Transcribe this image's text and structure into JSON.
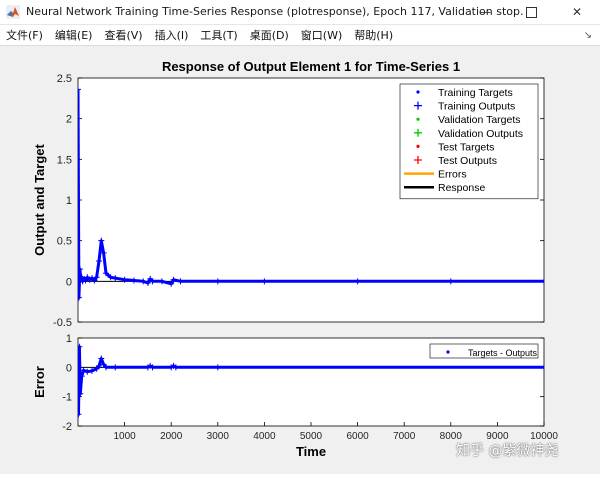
{
  "window": {
    "title": "Neural Network Training Time-Series Response (plotresponse), Epoch 117, Validation stop.",
    "app_icon": "matlab-icon"
  },
  "menu": [
    {
      "label": "文件(F)"
    },
    {
      "label": "编辑(E)"
    },
    {
      "label": "查看(V)"
    },
    {
      "label": "插入(I)"
    },
    {
      "label": "工具(T)"
    },
    {
      "label": "桌面(D)"
    },
    {
      "label": "窗口(W)"
    },
    {
      "label": "帮助(H)"
    }
  ],
  "watermark": "知乎 @紫微神尧",
  "chart_data": [
    {
      "type": "line",
      "title": "Response of Output Element 1 for Time-Series 1",
      "ylabel": "Output and Target",
      "xlim": [
        0,
        10000
      ],
      "ylim": [
        -0.5,
        2.5
      ],
      "yticks": [
        "-0.5",
        "0",
        "0.5",
        "1",
        "1.5",
        "2",
        "2.5"
      ],
      "legend_position": "top-right",
      "legend": [
        {
          "name": "Training Targets",
          "marker": "dot",
          "color": "#0000ff"
        },
        {
          "name": "Training Outputs",
          "marker": "plus",
          "color": "#0000ff"
        },
        {
          "name": "Validation Targets",
          "marker": "dot",
          "color": "#00cc00"
        },
        {
          "name": "Validation Outputs",
          "marker": "plus",
          "color": "#00cc00"
        },
        {
          "name": "Test Targets",
          "marker": "dot",
          "color": "#ff0000"
        },
        {
          "name": "Test Outputs",
          "marker": "plus",
          "color": "#ff0000"
        },
        {
          "name": "Errors",
          "marker": "line",
          "color": "#ffa500"
        },
        {
          "name": "Response",
          "marker": "line",
          "color": "#000000"
        }
      ],
      "series": [
        {
          "x": [
            0,
            20,
            40,
            60,
            80,
            100,
            130,
            160,
            200,
            250,
            300,
            350,
            400,
            450,
            500,
            550,
            600,
            700,
            800,
            1000,
            1200,
            1400,
            1500,
            1550,
            1600,
            1800,
            2000,
            2050,
            2200,
            3000,
            4000,
            6000,
            8000,
            10000
          ],
          "y": [
            2.36,
            -0.2,
            0.15,
            0.02,
            0.05,
            0.0,
            0.03,
            0.01,
            0.05,
            0.02,
            0.04,
            0.01,
            0.05,
            0.25,
            0.5,
            0.35,
            0.1,
            0.05,
            0.04,
            0.02,
            0.01,
            0.0,
            -0.02,
            0.03,
            0.0,
            0.0,
            -0.03,
            0.02,
            0.0,
            0.0,
            0.0,
            0.0,
            0.0,
            0.0
          ]
        }
      ]
    },
    {
      "type": "line",
      "ylabel": "Error",
      "xlabel": "Time",
      "xlim": [
        0,
        10000
      ],
      "ylim": [
        -2,
        1
      ],
      "yticks": [
        "-2",
        "-1",
        "0",
        "1"
      ],
      "xticks": [
        "1000",
        "2000",
        "3000",
        "4000",
        "5000",
        "6000",
        "7000",
        "8000",
        "9000",
        "10000"
      ],
      "legend_position": "top-right",
      "legend": [
        {
          "name": "Targets - Outputs",
          "marker": "dot",
          "color": "#0000ff"
        }
      ],
      "series": [
        {
          "x": [
            0,
            10,
            30,
            50,
            80,
            120,
            200,
            300,
            400,
            450,
            500,
            550,
            600,
            800,
            1500,
            1550,
            1600,
            2000,
            2050,
            2100,
            3000,
            10000
          ],
          "y": [
            0.0,
            -1.6,
            0.7,
            -0.9,
            -0.3,
            -0.1,
            -0.15,
            -0.12,
            -0.05,
            0.05,
            0.3,
            0.1,
            0.0,
            0.0,
            0.0,
            0.05,
            0.0,
            0.0,
            0.05,
            0.0,
            0.0,
            0.0
          ]
        }
      ]
    }
  ]
}
